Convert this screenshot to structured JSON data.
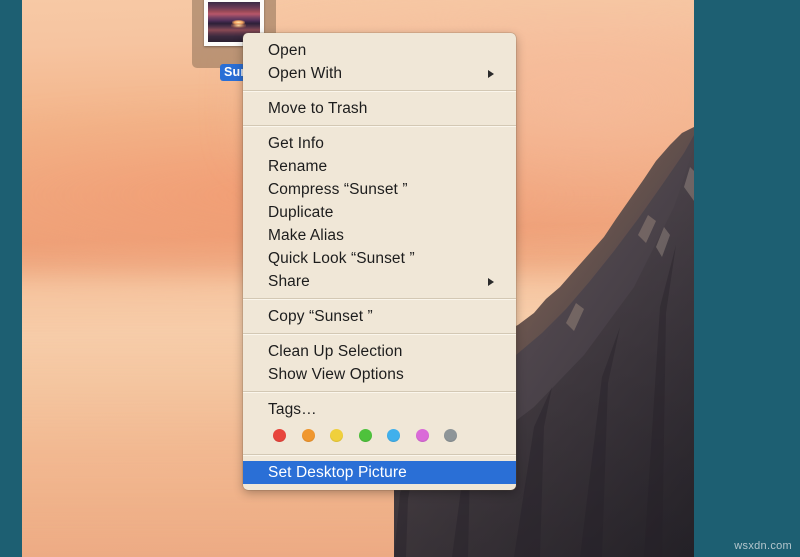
{
  "desktop": {
    "wallpaper_name": "yosemite-el-capitan-sunrise",
    "sky_color": "#f0a87e",
    "bar_color": "#1d5f72"
  },
  "file_icon": {
    "label": "Sunse",
    "full_name": "Sunset",
    "thumbnail_name": "sunset-photo-thumbnail",
    "selected": true
  },
  "context_menu": {
    "groups": [
      {
        "items": [
          {
            "label": "Open",
            "submenu": false,
            "highlighted": false
          },
          {
            "label": "Open With",
            "submenu": true,
            "highlighted": false
          }
        ]
      },
      {
        "items": [
          {
            "label": "Move to Trash",
            "submenu": false,
            "highlighted": false
          }
        ]
      },
      {
        "items": [
          {
            "label": "Get Info",
            "submenu": false,
            "highlighted": false
          },
          {
            "label": "Rename",
            "submenu": false,
            "highlighted": false
          },
          {
            "label": "Compress “Sunset ”",
            "submenu": false,
            "highlighted": false
          },
          {
            "label": "Duplicate",
            "submenu": false,
            "highlighted": false
          },
          {
            "label": "Make Alias",
            "submenu": false,
            "highlighted": false
          },
          {
            "label": "Quick Look “Sunset ”",
            "submenu": false,
            "highlighted": false
          },
          {
            "label": "Share",
            "submenu": true,
            "highlighted": false
          }
        ]
      },
      {
        "items": [
          {
            "label": "Copy “Sunset ”",
            "submenu": false,
            "highlighted": false
          }
        ]
      },
      {
        "items": [
          {
            "label": "Clean Up Selection",
            "submenu": false,
            "highlighted": false
          },
          {
            "label": "Show View Options",
            "submenu": false,
            "highlighted": false
          }
        ]
      },
      {
        "items": [
          {
            "label": "Tags…",
            "submenu": false,
            "highlighted": false
          }
        ],
        "tags": [
          {
            "name": "tag-red",
            "color": "#e8453c"
          },
          {
            "name": "tag-orange",
            "color": "#f0972e"
          },
          {
            "name": "tag-yellow",
            "color": "#f0d03c"
          },
          {
            "name": "tag-green",
            "color": "#4ec23c"
          },
          {
            "name": "tag-blue",
            "color": "#41b0ec"
          },
          {
            "name": "tag-purple",
            "color": "#da6ad8"
          },
          {
            "name": "tag-gray",
            "color": "#8e9598"
          }
        ]
      },
      {
        "items": [
          {
            "label": "Set Desktop Picture",
            "submenu": false,
            "highlighted": true
          }
        ]
      }
    ],
    "highlight_color": "#2a6fd6",
    "background_color": "#f0e7d7"
  },
  "watermark": {
    "text": "wsxdn.com"
  }
}
